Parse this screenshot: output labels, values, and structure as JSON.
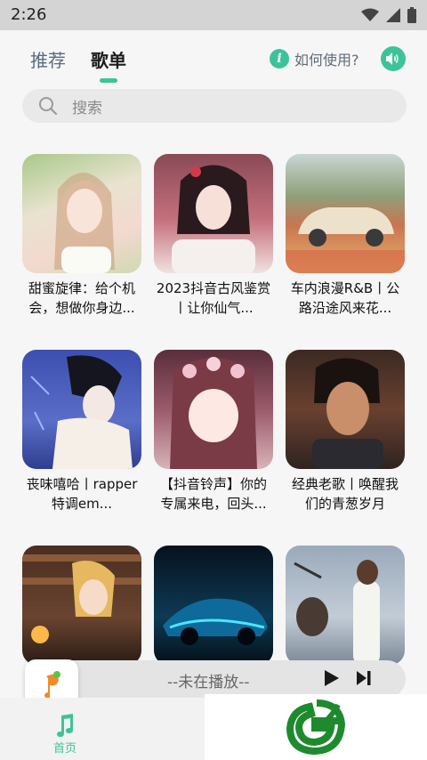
{
  "status_bar": {
    "time": "2:26"
  },
  "header": {
    "tabs": [
      {
        "label": "推荐",
        "active": false
      },
      {
        "label": "歌单",
        "active": true
      }
    ],
    "help_label": "如何使用?"
  },
  "search": {
    "placeholder": "搜索"
  },
  "playlists": [
    {
      "title": "甜蜜旋律：给个机会，想做你身边..."
    },
    {
      "title": "2023抖音古风鉴赏丨让你仙气..."
    },
    {
      "title": "车内浪漫R&B丨公路沿途风来花..."
    },
    {
      "title": "丧味嘻哈丨rapper特调em..."
    },
    {
      "title": "【抖音铃声】你的专属来电，回头..."
    },
    {
      "title": "经典老歌丨唤醒我们的青葱岁月"
    },
    {
      "title": ""
    },
    {
      "title": ""
    },
    {
      "title": ""
    }
  ],
  "player": {
    "status": "--未在播放--"
  },
  "bottom_nav": {
    "home_label": "首页"
  },
  "colors": {
    "accent": "#3dc39a",
    "background": "#f6f6f6",
    "status_bar": "#d4d4d4"
  }
}
